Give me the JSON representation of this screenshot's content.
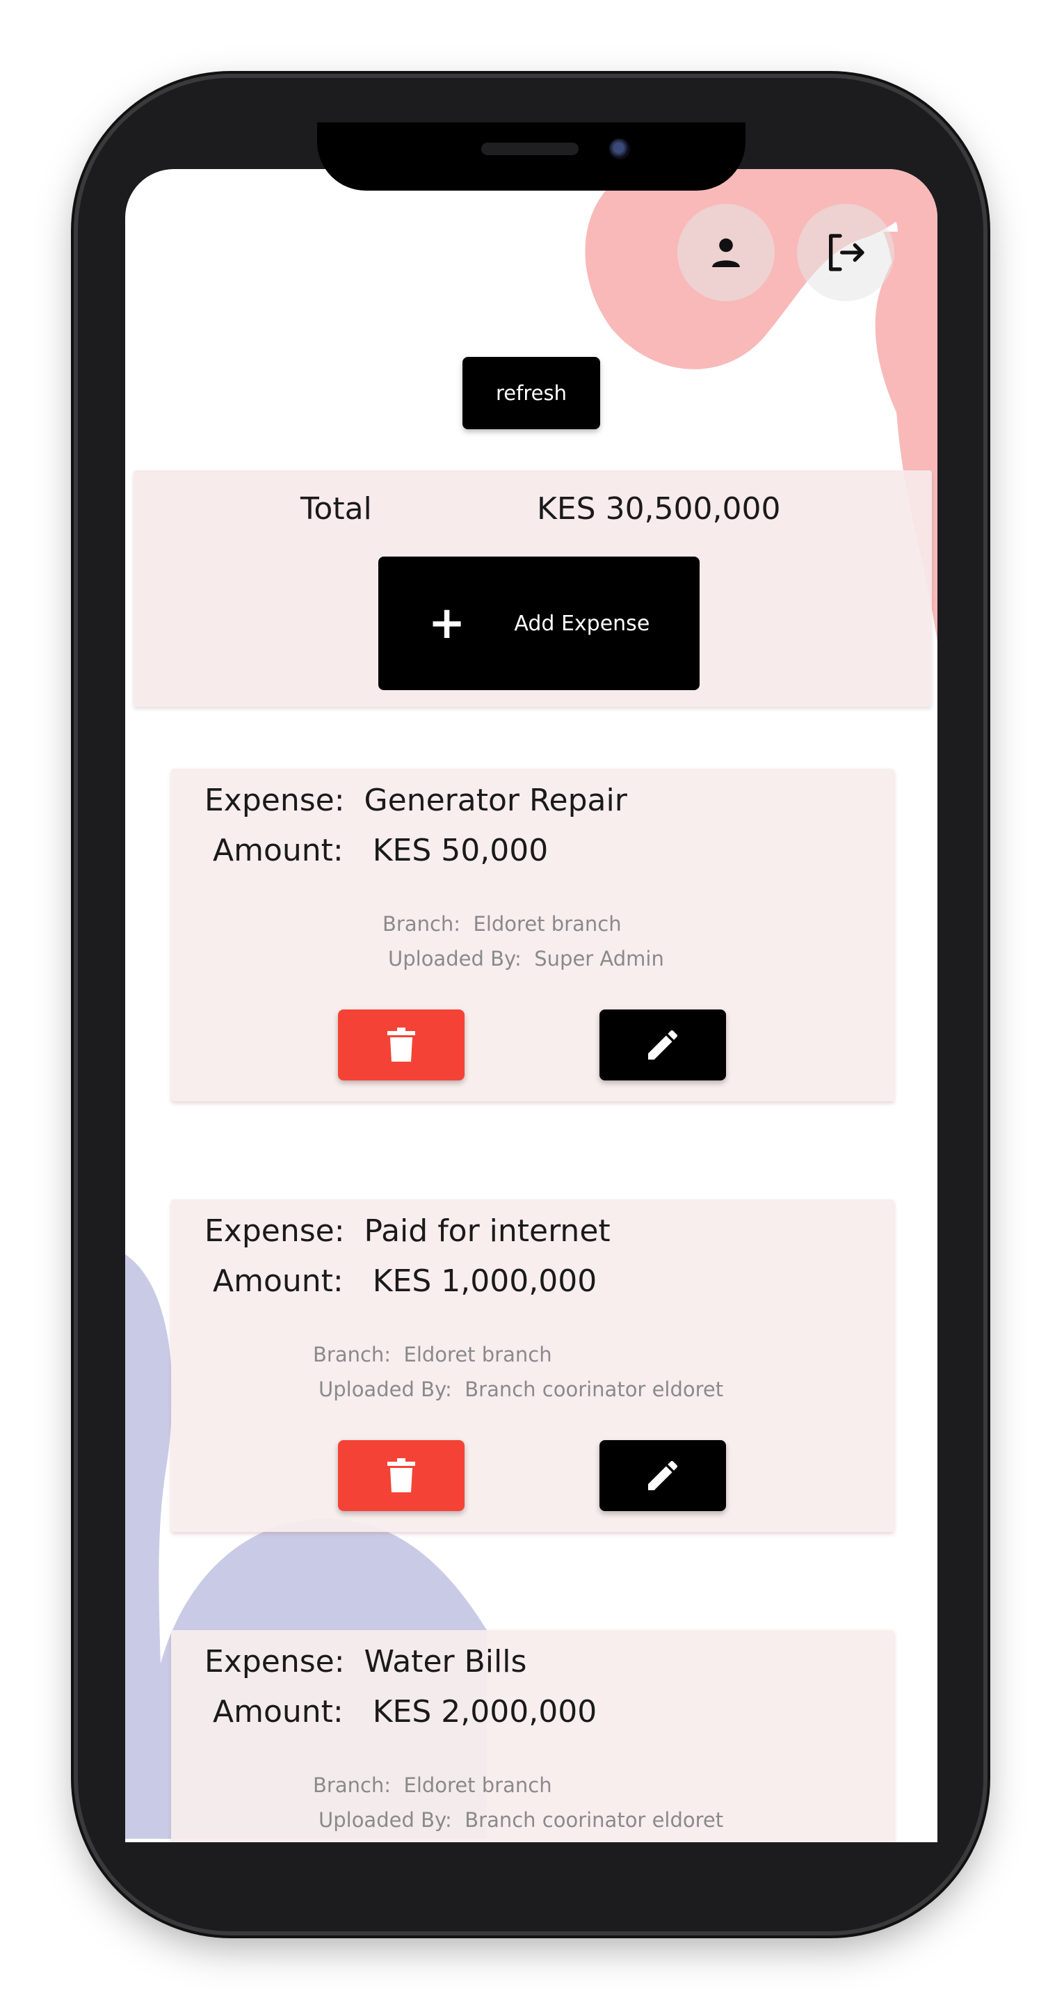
{
  "header": {
    "profile_icon": "person-icon",
    "logout_icon": "logout-icon"
  },
  "refresh_label": "refresh",
  "summary": {
    "total_label": "Total",
    "total_value": "KES 30,500,000",
    "add_label": "Add Expense",
    "add_icon": "plus-icon"
  },
  "expenses": [
    {
      "expense_label": "Expense:",
      "expense_name": "Generator Repair",
      "amount_label": "Amount:",
      "amount_value": "KES 50,000",
      "branch_label": "Branch:",
      "branch_value": "Eldoret branch",
      "uploaded_label": "Uploaded By:",
      "uploaded_value": "Super Admin"
    },
    {
      "expense_label": "Expense:",
      "expense_name": "Paid for internet",
      "amount_label": "Amount:",
      "amount_value": "KES 1,000,000",
      "branch_label": "Branch:",
      "branch_value": "Eldoret branch",
      "uploaded_label": "Uploaded By:",
      "uploaded_value": "Branch coorinator eldoret"
    },
    {
      "expense_label": "Expense:",
      "expense_name": "Water Bills",
      "amount_label": "Amount:",
      "amount_value": "KES 2,000,000",
      "branch_label": "Branch:",
      "branch_value": "Eldoret branch",
      "uploaded_label": "Uploaded By:",
      "uploaded_value": "Branch coorinator eldoret"
    }
  ],
  "colors": {
    "accent_black": "#000000",
    "delete_red": "#f44336",
    "card_bg": "#f8edec",
    "blob_pink": "#f9b9b9",
    "blob_lavender": "#c9cbe6"
  }
}
